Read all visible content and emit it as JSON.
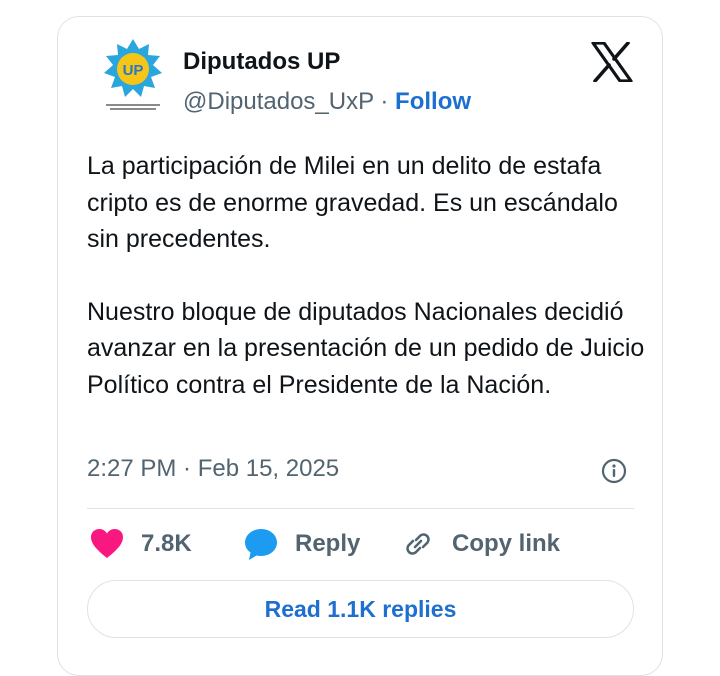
{
  "author": {
    "name": "Diputados UP",
    "handle": "@Diputados_UxP",
    "separator": "·",
    "follow_label": "Follow",
    "avatar_badge": "UP"
  },
  "tweet": {
    "paragraphs": [
      "La participación de Milei en un delito de estafa cripto es de enorme gravedad. Es un escándalo sin precedentes.",
      "Nuestro bloque de diputados Nacionales decidió avanzar en la presentación de un pedido de Juicio Político contra el Presidente de la Nación."
    ],
    "timestamp": "2:27 PM · Feb 15, 2025"
  },
  "actions": {
    "like_count": "7.8K",
    "reply_label": "Reply",
    "copy_label": "Copy link",
    "read_replies_label": "Read 1.1K replies"
  },
  "icons": {
    "platform": "x-logo-icon",
    "info": "info-icon",
    "like": "heart-icon",
    "reply": "speech-bubble-icon",
    "copy": "link-icon"
  },
  "colors": {
    "like": "#f91880",
    "reply": "#1d9bf0",
    "link": "#1d6fd0",
    "secondary_text": "#536471",
    "avatar_star": "#2aa6df",
    "avatar_badge": "#f5c518"
  }
}
